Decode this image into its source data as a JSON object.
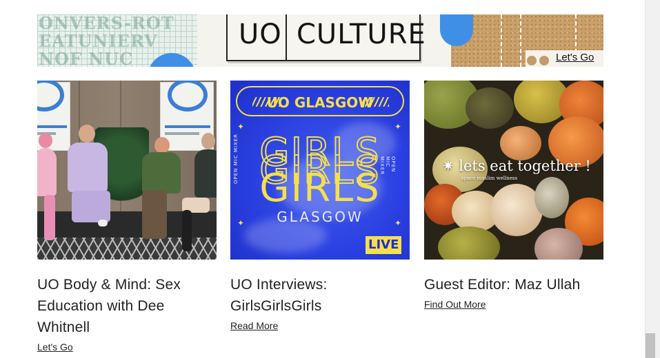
{
  "banner": {
    "left_word": "UO",
    "right_word": "CULTURE",
    "link_label": "Let's Go"
  },
  "cards": [
    {
      "title": "UO Body & Mind: Sex Education with Dee Whitnell",
      "link_label": "Let's Go",
      "image": "panel-discussion-photo"
    },
    {
      "title": "UO Interviews: GirlsGirlsGirls",
      "link_label": "Read More",
      "image": "girls-glasgow-poster",
      "poster": {
        "header": "UO GLASGOW",
        "big_word": "GIRLS",
        "city": "GLASGOW",
        "side_text": "OPEN MIC MIXER",
        "badge": "LIVE"
      }
    },
    {
      "title": "Guest Editor: Maz Ullah",
      "link_label": "Find Out More",
      "image": "fruit-still-life-photo",
      "overlay": {
        "title": "✷ lets eat together !",
        "subtitle": "space muslim wellness"
      }
    }
  ],
  "colors": {
    "accent_blue": "#3f8fe6",
    "poster_yellow": "#f5df4d",
    "poster_blue": "#2a3fe0",
    "text": "#222222"
  }
}
